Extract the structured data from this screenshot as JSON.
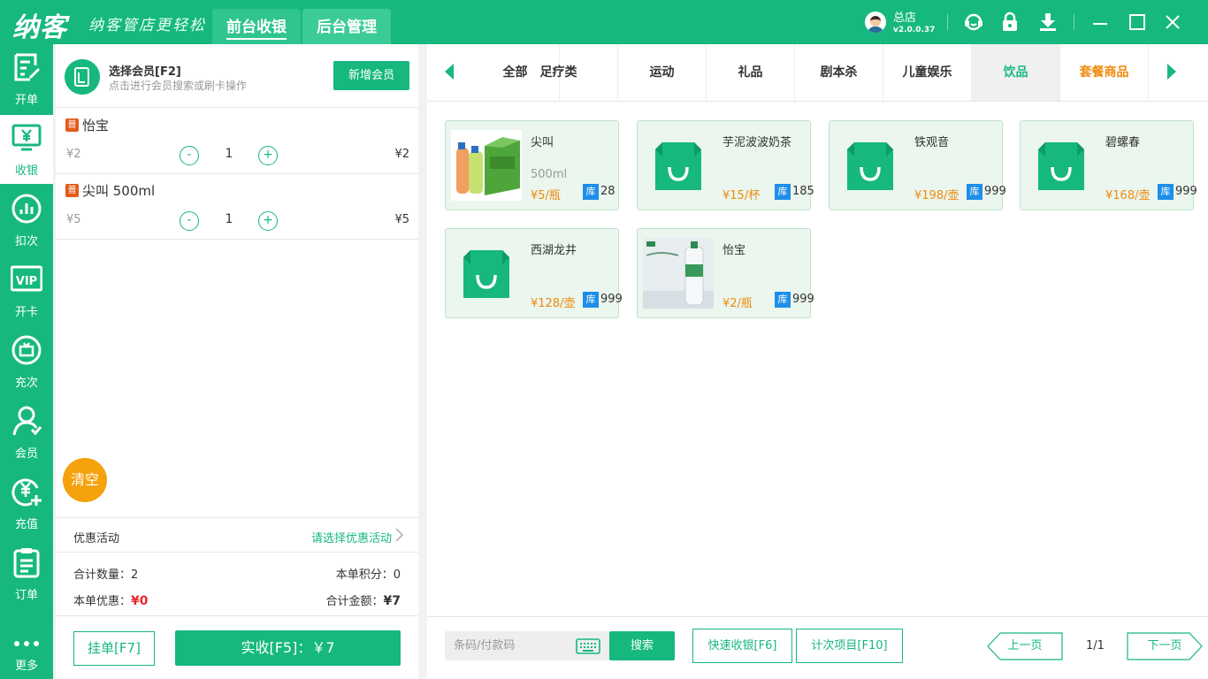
{
  "header": {
    "logo": "纳客",
    "slogan": "纳客管店更轻松",
    "tabs": [
      {
        "label": "前台收银",
        "active": true
      },
      {
        "label": "后台管理",
        "active": false
      }
    ],
    "store_name": "总店",
    "version": "v2.0.0.37",
    "icons": [
      "avatar",
      "headset-icon",
      "lock-icon",
      "download-icon",
      "minimize-icon",
      "maximize-icon",
      "close-icon"
    ]
  },
  "sidebar": {
    "items": [
      {
        "label": "开单",
        "icon": "edit-order-icon"
      },
      {
        "label": "收银",
        "icon": "cashier-icon",
        "active": true
      },
      {
        "label": "扣次",
        "icon": "chart-icon"
      },
      {
        "label": "开卡",
        "icon": "vip-icon"
      },
      {
        "label": "充次",
        "icon": "recharge-times-icon"
      },
      {
        "label": "会员",
        "icon": "member-icon"
      },
      {
        "label": "充值",
        "icon": "recharge-icon"
      },
      {
        "label": "订单",
        "icon": "order-icon"
      },
      {
        "label": "更多",
        "icon": "more-icon"
      }
    ]
  },
  "cart": {
    "member_title": "选择会员[F2]",
    "member_subtitle": "点击进行会员搜索或刷卡操作",
    "add_member_label": "新增会员",
    "items": [
      {
        "badge": "普",
        "name": "怡宝",
        "unit_price": "¥2",
        "minus": "-",
        "qty": "1",
        "plus": "+",
        "total": "¥2"
      },
      {
        "badge": "普",
        "name": "尖叫 500ml",
        "unit_price": "¥5",
        "minus": "-",
        "qty": "1",
        "plus": "+",
        "total": "¥5"
      }
    ],
    "clear_label": "清空",
    "promo_label": "优惠活动",
    "promo_link": "请选择优惠活动",
    "total_qty_label": "合计数量：",
    "total_qty": "2",
    "points_label": "本单积分：",
    "points": "0",
    "discount_label": "本单优惠：",
    "discount": "¥0",
    "total_amount_label": "合计金额：",
    "total_amount": "¥7",
    "hang_label": "挂单[F7]",
    "pay_label": "实收[F5]：￥7"
  },
  "categories": {
    "items": [
      {
        "label": "全部"
      },
      {
        "label": "足疗类"
      },
      {
        "label": "运动"
      },
      {
        "label": "礼品"
      },
      {
        "label": "剧本杀"
      },
      {
        "label": "儿童娱乐"
      },
      {
        "label": "饮品",
        "active": true
      },
      {
        "label": "套餐商品",
        "accent": "#f08a0c"
      }
    ]
  },
  "products": [
    {
      "name": "尖叫",
      "spec": "500ml",
      "price": "¥5/瓶",
      "stock_badge": "库",
      "stock": "28",
      "image": "drink-photo"
    },
    {
      "name": "芋泥波波奶茶",
      "spec": "",
      "price": "¥15/杯",
      "stock_badge": "库",
      "stock": "185",
      "image": "bag-icon"
    },
    {
      "name": "铁观音",
      "spec": "",
      "price": "¥198/壶",
      "stock_badge": "库",
      "stock": "999",
      "image": "bag-icon"
    },
    {
      "name": "碧螺春",
      "spec": "",
      "price": "¥168/壶",
      "stock_badge": "库",
      "stock": "999",
      "image": "bag-icon"
    },
    {
      "name": "西湖龙井",
      "spec": "",
      "price": "¥128/壶",
      "stock_badge": "库",
      "stock": "999",
      "image": "bag-icon"
    },
    {
      "name": "怡宝",
      "spec": "",
      "price": "¥2/瓶",
      "stock_badge": "库",
      "stock": "999",
      "image": "water-photo"
    }
  ],
  "bottom": {
    "search_placeholder": "条码/付款码",
    "search_label": "搜索",
    "quick_cashier_label": "快速收银[F6]",
    "count_items_label": "计次项目[F10]",
    "prev_label": "上一页",
    "page_info": "1/1",
    "next_label": "下一页"
  },
  "colors": {
    "brand": "#16b87e",
    "accent": "#f08a0c",
    "danger": "#e8292e",
    "stock_badge": "#1e8ee8"
  }
}
